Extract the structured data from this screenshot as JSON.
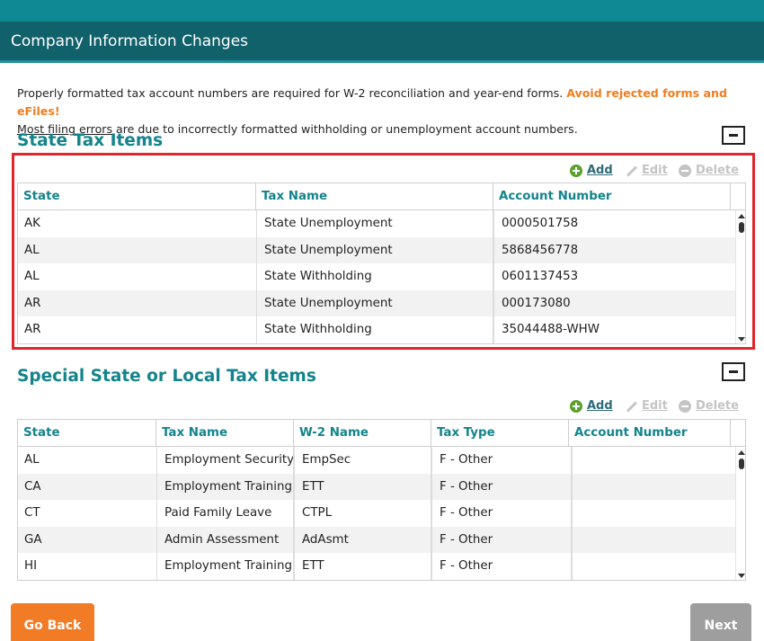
{
  "window": {
    "title": "Company Information Changes"
  },
  "intro": {
    "line1_text": "Properly formatted tax account numbers are required for W-2 reconciliation and year-end forms. ",
    "line1_warning": "Avoid rejected forms and eFiles!",
    "line2_link": "Most filing errors",
    "line2_text": " are due to incorrectly formatted withholding or unemployment account numbers."
  },
  "state_tax": {
    "title": "State Tax Items",
    "actions": {
      "add": "Add",
      "edit": "Edit",
      "delete": "Delete"
    },
    "columns": [
      "State",
      "Tax Name",
      "Account Number"
    ],
    "rows": [
      [
        "AK",
        "State Unemployment",
        "0000501758"
      ],
      [
        "AL",
        "State Unemployment",
        "5868456778"
      ],
      [
        "AL",
        "State Withholding",
        "0601137453"
      ],
      [
        "AR",
        "State Unemployment",
        "000173080"
      ],
      [
        "AR",
        "State Withholding",
        "35044488-WHW"
      ]
    ]
  },
  "special_tax": {
    "title": "Special State or Local Tax Items",
    "actions": {
      "add": "Add",
      "edit": "Edit",
      "delete": "Delete"
    },
    "columns": [
      "State",
      "Tax Name",
      "W-2 Name",
      "Tax Type",
      "Account Number"
    ],
    "rows": [
      [
        "AL",
        "Employment Security Assessment",
        "EmpSec",
        "F - Other",
        ""
      ],
      [
        "CA",
        "Employment Training Tax",
        "ETT",
        "F - Other",
        ""
      ],
      [
        "CT",
        "Paid Family Leave",
        "CTPL",
        "F - Other",
        ""
      ],
      [
        "GA",
        "Admin Assessment",
        "AdAsmt",
        "F - Other",
        ""
      ],
      [
        "HI",
        "Employment Training Tax",
        "ETT",
        "F - Other",
        ""
      ]
    ]
  },
  "footer": {
    "back_label": "Go Back",
    "next_label": "Next"
  },
  "colors": {
    "accent": "#13848c",
    "warning": "#f07d1e",
    "back_button": "#f27b25",
    "next_button": "#9e9e9e",
    "highlight": "#e0262b"
  }
}
